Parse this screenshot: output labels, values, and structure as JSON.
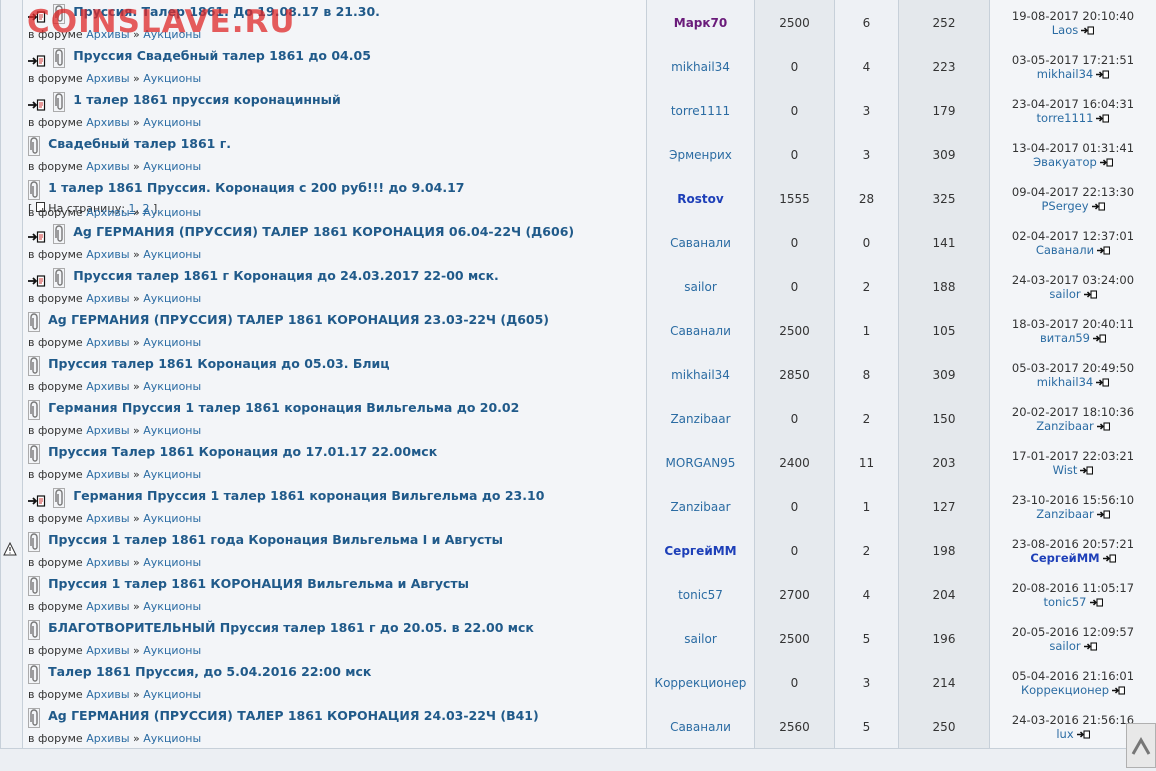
{
  "watermark": "COINSLAVE.RU",
  "in_forum_label": "в форуме",
  "breadcrumb_sep": "»",
  "forum_archive": "Архивы",
  "forum_auctions": "Аукционы",
  "pages_label": "На страницу:",
  "rows": [
    {
      "title": "Пруссия. Талер 1861. До 19.08.17 в 21.30.",
      "author": "Марк70",
      "author_style": "p",
      "col3": "2500",
      "col4": "6",
      "col5": "252",
      "date": "19-08-2017 20:10:40",
      "last": "Laos",
      "last_style": "",
      "icon": "redirect",
      "warn": false,
      "pages": null
    },
    {
      "title": "Пруссия Свадебный талер 1861 до 04.05",
      "author": "mikhail34",
      "author_style": "",
      "col3": "0",
      "col4": "4",
      "col5": "223",
      "date": "03-05-2017 17:21:51",
      "last": "mikhail34",
      "last_style": "",
      "icon": "redirect",
      "warn": false,
      "pages": null
    },
    {
      "title": "1 талер 1861 пруссия коронацинный",
      "author": "torre1111",
      "author_style": "",
      "col3": "0",
      "col4": "3",
      "col5": "179",
      "date": "23-04-2017 16:04:31",
      "last": "torre1111",
      "last_style": "",
      "icon": "redirect",
      "warn": false,
      "pages": null
    },
    {
      "title": "Свадебный талер 1861 г.",
      "author": "Эрменрих",
      "author_style": "",
      "col3": "0",
      "col4": "3",
      "col5": "309",
      "date": "13-04-2017 01:31:41",
      "last": "Эвакуатор",
      "last_style": "",
      "icon": "clip",
      "warn": false,
      "pages": null
    },
    {
      "title": "1 талер 1861 Пруссия. Коронация с 200 руб!!! до 9.04.17",
      "author": "Rostov",
      "author_style": "b",
      "col3": "1555",
      "col4": "28",
      "col5": "325",
      "date": "09-04-2017 22:13:30",
      "last": "PSergey",
      "last_style": "",
      "icon": "clip",
      "warn": false,
      "pages": [
        "1",
        "2"
      ]
    },
    {
      "title": "Ag ГЕРМАНИЯ (ПРУССИЯ) ТАЛЕР 1861 КОРОНАЦИЯ 06.04-22Ч (Д606)",
      "author": "Саванали",
      "author_style": "",
      "col3": "0",
      "col4": "0",
      "col5": "141",
      "date": "02-04-2017 12:37:01",
      "last": "Саванали",
      "last_style": "",
      "icon": "redirect",
      "warn": false,
      "pages": null
    },
    {
      "title": "Пруссия талер 1861 г Коронация до 24.03.2017 22-00 мск.",
      "author": "sailor",
      "author_style": "",
      "col3": "0",
      "col4": "2",
      "col5": "188",
      "date": "24-03-2017 03:24:00",
      "last": "sailor",
      "last_style": "",
      "icon": "redirect",
      "warn": false,
      "pages": null
    },
    {
      "title": "Ag ГЕРМАНИЯ (ПРУССИЯ) ТАЛЕР 1861 КОРОНАЦИЯ 23.03-22Ч (Д605)",
      "author": "Саванали",
      "author_style": "",
      "col3": "2500",
      "col4": "1",
      "col5": "105",
      "date": "18-03-2017 20:40:11",
      "last": "витал59",
      "last_style": "",
      "icon": "clip",
      "warn": false,
      "pages": null
    },
    {
      "title": "Пруссия талер 1861 Коронация до 05.03. Блиц",
      "author": "mikhail34",
      "author_style": "",
      "col3": "2850",
      "col4": "8",
      "col5": "309",
      "date": "05-03-2017 20:49:50",
      "last": "mikhail34",
      "last_style": "",
      "icon": "clip",
      "warn": false,
      "pages": null
    },
    {
      "title": "Германия Пруссия 1 талер 1861 коронация Вильгельма до 20.02",
      "author": "Zanzibaar",
      "author_style": "",
      "col3": "0",
      "col4": "2",
      "col5": "150",
      "date": "20-02-2017 18:10:36",
      "last": "Zanzibaar",
      "last_style": "",
      "icon": "clip",
      "warn": false,
      "pages": null
    },
    {
      "title": "Пруссия Талер 1861 Коронация до 17.01.17 22.00мск",
      "author": "MORGAN95",
      "author_style": "",
      "col3": "2400",
      "col4": "11",
      "col5": "203",
      "date": "17-01-2017 22:03:21",
      "last": "Wist",
      "last_style": "",
      "icon": "clip",
      "warn": false,
      "pages": null
    },
    {
      "title": "Германия Пруссия 1 талер 1861 коронация Вильгельма до 23.10",
      "author": "Zanzibaar",
      "author_style": "",
      "col3": "0",
      "col4": "1",
      "col5": "127",
      "date": "23-10-2016 15:56:10",
      "last": "Zanzibaar",
      "last_style": "",
      "icon": "redirect",
      "warn": false,
      "pages": null
    },
    {
      "title": "Пруссия 1 талер 1861 года Коронация Вильгельма I и Августы",
      "author": "СергейММ",
      "author_style": "b",
      "col3": "0",
      "col4": "2",
      "col5": "198",
      "date": "23-08-2016 20:57:21",
      "last": "СергейММ",
      "last_style": "b",
      "icon": "clip",
      "warn": true,
      "pages": null
    },
    {
      "title": "Пруссия 1 талер 1861 КОРОНАЦИЯ Вильгельма и Августы",
      "author": "tonic57",
      "author_style": "",
      "col3": "2700",
      "col4": "4",
      "col5": "204",
      "date": "20-08-2016 11:05:17",
      "last": "tonic57",
      "last_style": "",
      "icon": "clip",
      "warn": false,
      "pages": null
    },
    {
      "title": "БЛАГОТВОРИТЕЛЬНЫЙ Пруссия талер 1861 г до 20.05. в 22.00 мск",
      "author": "sailor",
      "author_style": "",
      "col3": "2500",
      "col4": "5",
      "col5": "196",
      "date": "20-05-2016 12:09:57",
      "last": "sailor",
      "last_style": "",
      "icon": "clip",
      "warn": false,
      "pages": null
    },
    {
      "title": "Талер 1861 Пруссия, до 5.04.2016 22:00 мск",
      "author": "Коррекционер",
      "author_style": "",
      "col3": "0",
      "col4": "3",
      "col5": "214",
      "date": "05-04-2016 21:16:01",
      "last": "Коррекционер",
      "last_style": "",
      "icon": "clip",
      "warn": false,
      "pages": null
    },
    {
      "title": "Ag ГЕРМАНИЯ (ПРУССИЯ) ТАЛЕР 1861 КОРОНАЦИЯ 24.03-22Ч (В41)",
      "author": "Саванали",
      "author_style": "",
      "col3": "2560",
      "col4": "5",
      "col5": "250",
      "date": "24-03-2016 21:56:16",
      "last": "lux",
      "last_style": "",
      "icon": "clip",
      "warn": false,
      "pages": null
    }
  ]
}
